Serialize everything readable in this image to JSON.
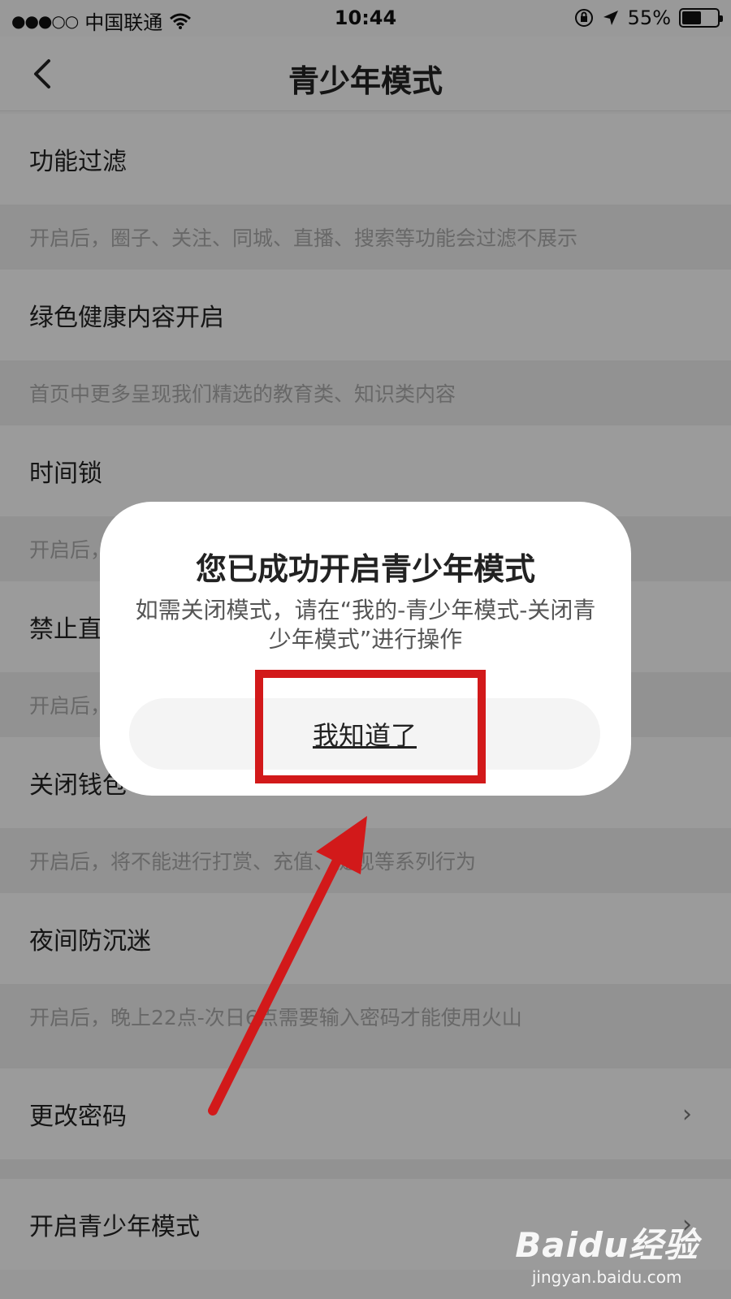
{
  "status_bar": {
    "signal": "●●●○○",
    "carrier": "中国联通",
    "time": "10:44",
    "battery_text": "55%",
    "battery_level": 0.55
  },
  "nav": {
    "title": "青少年模式"
  },
  "settings": [
    {
      "title": "功能过滤",
      "desc": "开启后，圈子、关注、同城、直播、搜索等功能会过滤不展示"
    },
    {
      "title": "绿色健康内容开启",
      "desc": "首页中更多呈现我们精选的教育类、知识类内容"
    },
    {
      "title": "时间锁",
      "desc": "开启后，"
    },
    {
      "title": "禁止直",
      "desc": "开启后，"
    },
    {
      "title": "关闭钱包",
      "desc": "开启后，将不能进行打赏、充值、提现等系列行为"
    },
    {
      "title": "夜间防沉迷",
      "desc": "开启后，晚上22点-次日6点需要输入密码才能使用火山"
    }
  ],
  "links": {
    "change_password": "更改密码",
    "enable_teen_mode": "开启青少年模式",
    "chevron": "›"
  },
  "dialog": {
    "title": "您已成功开启青少年模式",
    "message": "如需关闭模式，请在“我的-青少年模式-关闭青少年模式”进行操作",
    "button": "我知道了"
  },
  "annotation": {
    "color": "#d2191a"
  },
  "watermark": {
    "logo": "Baidu经验",
    "url": "jingyan.baidu.com"
  }
}
